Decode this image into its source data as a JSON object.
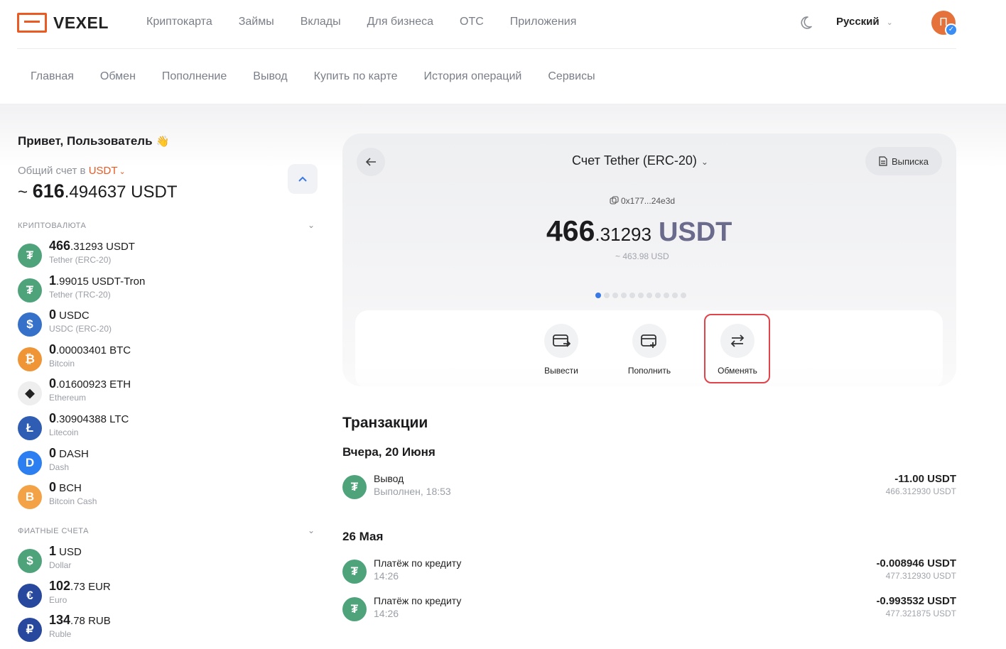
{
  "header": {
    "logo_text": "VEXEL",
    "nav": [
      "Криптокарта",
      "Займы",
      "Вклады",
      "Для бизнеса",
      "OTC",
      "Приложения"
    ],
    "language": "Русский",
    "avatar_letter": "П"
  },
  "subnav": [
    "Главная",
    "Обмен",
    "Пополнение",
    "Вывод",
    "Купить по карте",
    "История операций",
    "Сервисы"
  ],
  "sidebar": {
    "greeting": "Привет, Пользователь",
    "greeting_emoji": "👋",
    "account_label": "Общий счет в",
    "account_currency": "USDT",
    "total_prefix": "~ ",
    "total_int": "616",
    "total_frac": ".494637",
    "total_currency": " USDT",
    "crypto_title": "КРИПТОВАЛЮТА",
    "crypto": [
      {
        "int": "466",
        "frac": ".31293",
        "cur": " USDT",
        "name": "Tether (ERC-20)",
        "icon": "tether-icon",
        "color": "#4fa37b",
        "glyph": "₮"
      },
      {
        "int": "1",
        "frac": ".99015",
        "cur": " USDT-Tron",
        "name": "Tether (TRC-20)",
        "icon": "tether-icon",
        "color": "#4fa37b",
        "glyph": "₮"
      },
      {
        "int": "0",
        "frac": "",
        "cur": " USDC",
        "name": "USDC (ERC-20)",
        "icon": "usdc-icon",
        "color": "#3570c9",
        "glyph": "$"
      },
      {
        "int": "0",
        "frac": ".00003401",
        "cur": " BTC",
        "name": "Bitcoin",
        "icon": "bitcoin-icon",
        "color": "#ef9536",
        "glyph": "₿"
      },
      {
        "int": "0",
        "frac": ".01600923",
        "cur": " ETH",
        "name": "Ethereum",
        "icon": "ethereum-icon",
        "color": "#eeeeef",
        "glyph": "◆"
      },
      {
        "int": "0",
        "frac": ".30904388",
        "cur": " LTC",
        "name": "Litecoin",
        "icon": "litecoin-icon",
        "color": "#2f5db4",
        "glyph": "Ł"
      },
      {
        "int": "0",
        "frac": "",
        "cur": " DASH",
        "name": "Dash",
        "icon": "dash-icon",
        "color": "#2b7ff0",
        "glyph": "D"
      },
      {
        "int": "0",
        "frac": "",
        "cur": " BCH",
        "name": "Bitcoin Cash",
        "icon": "bitcoin-cash-icon",
        "color": "#f3a246",
        "glyph": "B"
      }
    ],
    "fiat_title": "ФИАТНЫЕ СЧЕТА",
    "fiat": [
      {
        "int": "1",
        "frac": "",
        "cur": " USD",
        "name": "Dollar",
        "icon": "dollar-icon",
        "color": "#4fa37b",
        "glyph": "$"
      },
      {
        "int": "102",
        "frac": ".73",
        "cur": " EUR",
        "name": "Euro",
        "icon": "euro-icon",
        "color": "#27489c",
        "glyph": "€"
      },
      {
        "int": "134",
        "frac": ".78",
        "cur": " RUB",
        "name": "Ruble",
        "icon": "ruble-icon",
        "color": "#27489c",
        "glyph": "₽"
      }
    ]
  },
  "card": {
    "title": "Счет Tether (ERC-20)",
    "statement_label": "Выписка",
    "address": "0x177...24e3d",
    "balance_int": "466",
    "balance_frac": ".31293",
    "balance_currency": "USDT",
    "usd_approx": "~ 463.98 USD",
    "dots_count": 11,
    "dots_active": 0,
    "actions": [
      {
        "label": "Вывести",
        "icon": "withdraw-icon"
      },
      {
        "label": "Пополнить",
        "icon": "deposit-icon"
      },
      {
        "label": "Обменять",
        "icon": "exchange-icon"
      }
    ]
  },
  "transactions": {
    "title": "Транзакции",
    "groups": [
      {
        "date": "Вчера, 20 Июня",
        "items": [
          {
            "name": "Вывод",
            "status": "Выполнен, 18:53",
            "amount": "-11.00 USDT",
            "balance": "466.312930 USDT"
          }
        ]
      },
      {
        "date": "26 Мая",
        "items": [
          {
            "name": "Платёж по кредиту",
            "status": "14:26",
            "amount": "-0.008946 USDT",
            "balance": "477.312930 USDT"
          },
          {
            "name": "Платёж по кредиту",
            "status": "14:26",
            "amount": "-0.993532 USDT",
            "balance": "477.321875 USDT"
          }
        ]
      }
    ]
  },
  "colors": {
    "brand": "#ea5a23",
    "accent": "#3a78e6",
    "highlight": "#e0434a",
    "tether": "#4fa37b"
  }
}
